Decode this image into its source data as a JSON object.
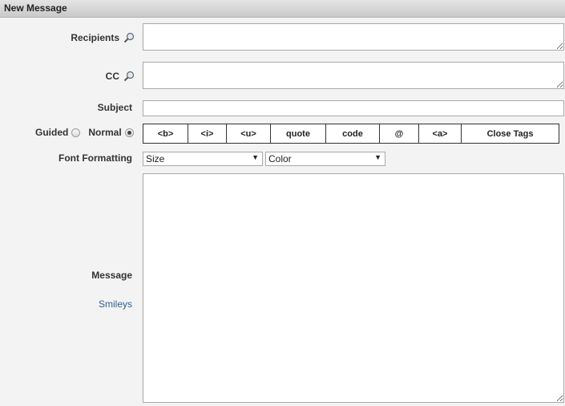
{
  "header": {
    "title": "New Message"
  },
  "fields": {
    "recipients_label": "Recipients",
    "recipients_value": "",
    "cc_label": "CC",
    "cc_value": "",
    "subject_label": "Subject",
    "subject_value": "",
    "message_label": "Message",
    "message_value": "",
    "smileys_link": "Smileys"
  },
  "mode": {
    "guided_label": "Guided",
    "normal_label": "Normal",
    "selected": "Normal"
  },
  "toolbar": {
    "buttons": [
      "<b>",
      "<i>",
      "<u>",
      "quote",
      "code",
      "@",
      "<a>",
      "Close Tags"
    ]
  },
  "font_formatting": {
    "label": "Font Formatting",
    "size_selected": "Size",
    "color_selected": "Color"
  }
}
